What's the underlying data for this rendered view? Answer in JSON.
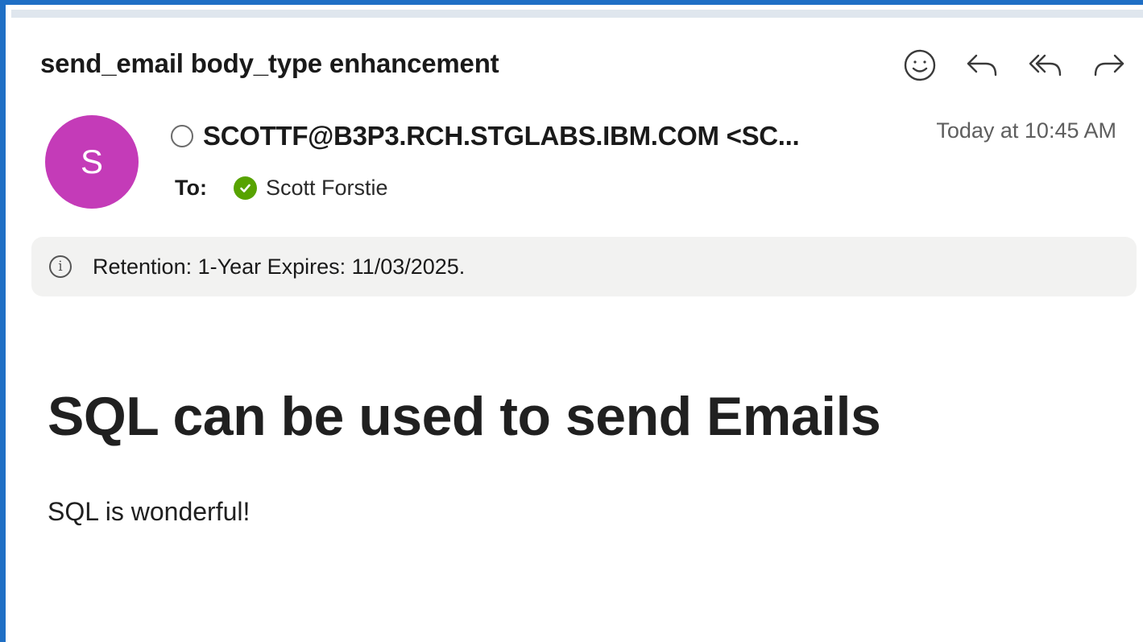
{
  "email": {
    "subject": "send_email body_type enhancement",
    "sender": {
      "initial": "S",
      "display": "SCOTTF@B3P3.RCH.STGLABS.IBM.COM <SC...",
      "avatar_color": "#c43bb8"
    },
    "timestamp": "Today at 10:45 AM",
    "to_label": "To:",
    "recipient": "Scott Forstie",
    "retention_notice": "Retention: 1-Year Expires: 11/03/2025.",
    "body": {
      "heading": "SQL can be used to send Emails",
      "paragraph": "SQL is wonderful!"
    }
  },
  "actions": {
    "icons": [
      "emoji-icon",
      "reply-icon",
      "reply-all-icon",
      "forward-icon"
    ]
  },
  "colors": {
    "frame_border": "#1f6fc5",
    "verified_badge": "#57a300",
    "retention_bg": "#f2f2f1"
  }
}
